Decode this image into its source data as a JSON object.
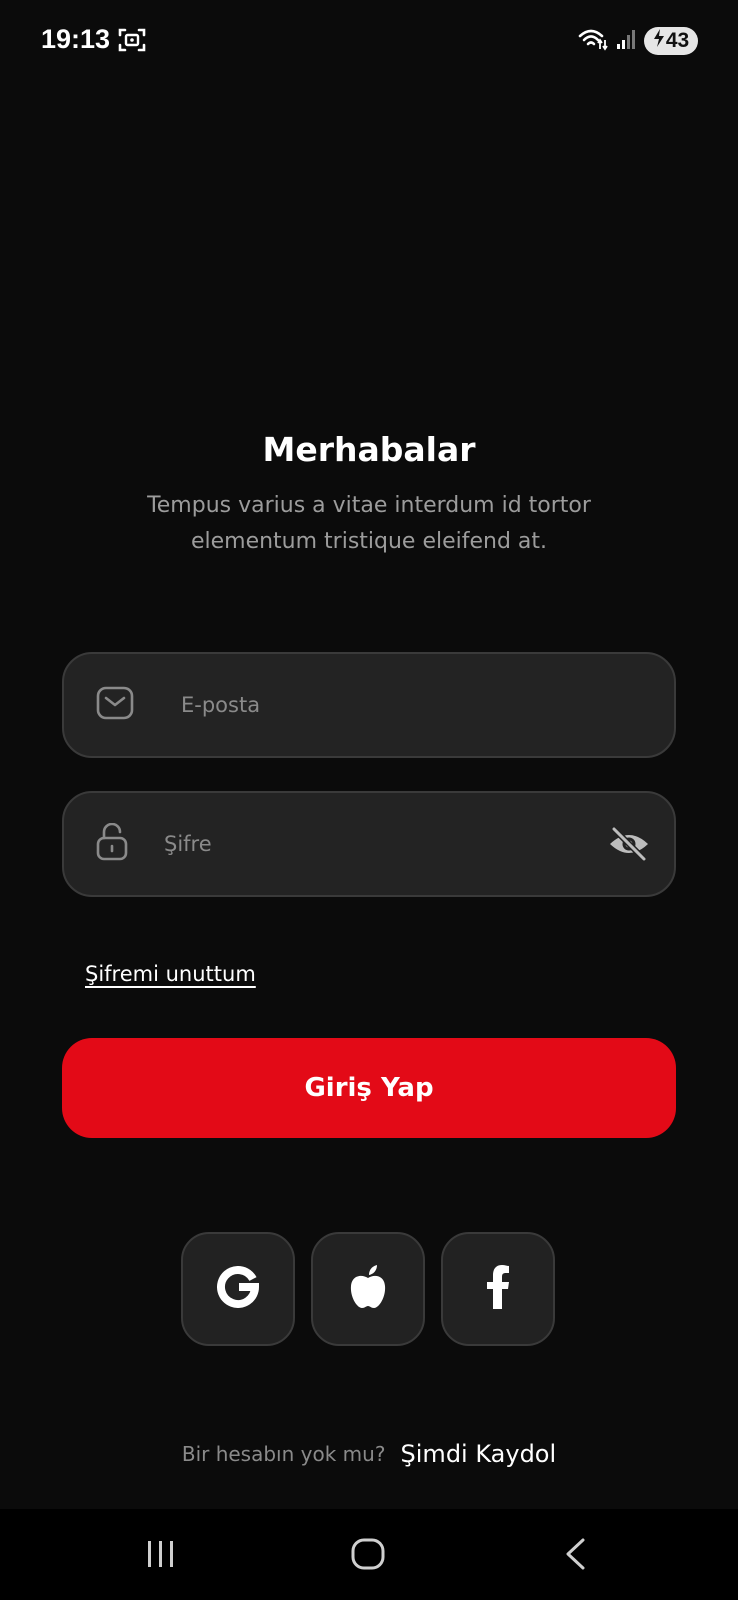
{
  "status_bar": {
    "time": "19:13",
    "battery_level": "43",
    "icons": [
      "screenshot-icon",
      "wifi-icon",
      "signal-icon",
      "charging-icon"
    ]
  },
  "header": {
    "title": "Merhabalar",
    "subtitle": "Tempus varius a vitae interdum id tortor elementum tristique eleifend at."
  },
  "form": {
    "email": {
      "placeholder": "E-posta",
      "value": "",
      "icon": "mail-icon"
    },
    "password": {
      "placeholder": "Şifre",
      "value": "",
      "icon": "unlock-icon",
      "toggle_icon": "eye-off-icon"
    },
    "forgot_label": "Şifremi unuttum",
    "submit_label": "Giriş Yap"
  },
  "social": {
    "items": [
      {
        "name": "google",
        "icon": "google-icon"
      },
      {
        "name": "apple",
        "icon": "apple-icon"
      },
      {
        "name": "facebook",
        "icon": "facebook-icon"
      }
    ]
  },
  "signup": {
    "question": "Bir hesabın yok mu?",
    "link_label": "Şimdi Kaydol"
  },
  "nav_bar": {
    "items": [
      "recents-icon",
      "home-icon",
      "back-icon"
    ]
  },
  "colors": {
    "background": "#0b0b0b",
    "field_background": "#232323",
    "accent": "#e30a17",
    "muted_text": "#8a8a8a"
  }
}
